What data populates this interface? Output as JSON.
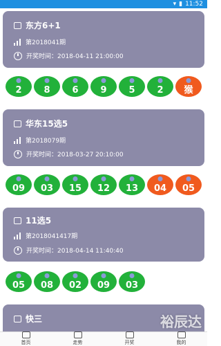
{
  "status": {
    "time": "11:52"
  },
  "cards": [
    {
      "title": "东方6+1",
      "issue": "第2018041期",
      "open_time": "开奖时间：2018-04-11 21:00:00",
      "balls": [
        {
          "v": "2",
          "c": "green"
        },
        {
          "v": "8",
          "c": "green"
        },
        {
          "v": "6",
          "c": "green"
        },
        {
          "v": "9",
          "c": "green"
        },
        {
          "v": "5",
          "c": "green"
        },
        {
          "v": "2",
          "c": "green"
        },
        {
          "v": "猴",
          "c": "red"
        }
      ]
    },
    {
      "title": "华东15选5",
      "issue": "第2018079期",
      "open_time": "开奖时间：2018-03-27 20:10:00",
      "balls": [
        {
          "v": "09",
          "c": "green"
        },
        {
          "v": "03",
          "c": "green"
        },
        {
          "v": "15",
          "c": "green"
        },
        {
          "v": "12",
          "c": "green"
        },
        {
          "v": "13",
          "c": "green"
        },
        {
          "v": "04",
          "c": "red"
        },
        {
          "v": "05",
          "c": "red"
        }
      ]
    },
    {
      "title": "11选5",
      "issue": "第2018041417期",
      "open_time": "开奖时间：2018-04-14 11:40:40",
      "balls": [
        {
          "v": "05",
          "c": "green"
        },
        {
          "v": "08",
          "c": "green"
        },
        {
          "v": "02",
          "c": "green"
        },
        {
          "v": "09",
          "c": "green"
        },
        {
          "v": "03",
          "c": "green"
        }
      ]
    },
    {
      "title": "快三"
    }
  ],
  "tabs": [
    {
      "label": "首页"
    },
    {
      "label": "走势"
    },
    {
      "label": "开奖"
    },
    {
      "label": "我的"
    }
  ],
  "watermark": "裕辰达"
}
